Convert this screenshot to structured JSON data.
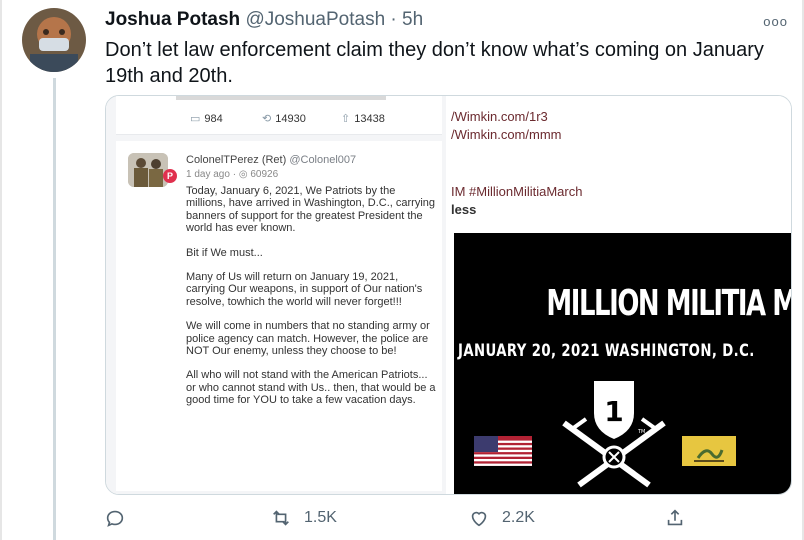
{
  "tweet": {
    "display_name": "Joshua Potash",
    "handle": "@JoshuaPotash",
    "separator": " · ",
    "time": "5h",
    "more_icon": "ooo",
    "text": "Don’t let law enforcement claim they don’t know what’s coming on January 19th and 20th."
  },
  "embedded_left": {
    "stats": {
      "comments": "984",
      "reposts": "14930",
      "upvotes": "13438"
    },
    "post": {
      "author": "ColonelTPerez (Ret)",
      "author_handle": "@Colonel007",
      "time_ago": "1 day ago · ",
      "views": "60926",
      "badge": "P",
      "p1": "Today, January 6, 2021, We Patriots by the millions, have arrived in Washington, D.C., carrying banners of support for the greatest President the world has ever known.",
      "p2": "Bit if We must...",
      "p3": "Many of Us will return on January 19, 2021, carrying Our weapons, in support of Our nation's resolve, towhich the world will never forget!!!",
      "p4": "We will come in numbers that no standing army or police agency can match. However, the police are NOT Our enemy, unless they choose to be!",
      "p5": "All who will not stand with the American Patriots... or who cannot stand with Us.. then, that would be a good time for YOU to take a few vacation days."
    }
  },
  "embedded_right": {
    "link1": "/Wimkin.com/1r3",
    "link2": "/Wimkin.com/mmm",
    "hashtag_line": "IM #MillionMilitiaMarch",
    "less": "less",
    "poster_title": "MILLION MILITIA MARCH",
    "poster_subtitle": "JANUARY 20, 2021 WASHINGTON, D.C.",
    "logo_number": "1",
    "logo_tm": "TM"
  },
  "actions": {
    "reply_icon": "reply-icon",
    "retweet_count": "1.5K",
    "like_count": "2.2K",
    "share_icon": "share-icon"
  },
  "colors": {
    "text": "#0f1419",
    "secondary": "#536471",
    "border": "#cfd9de",
    "poster_bg": "#000000",
    "parler_red": "#e0304e"
  }
}
